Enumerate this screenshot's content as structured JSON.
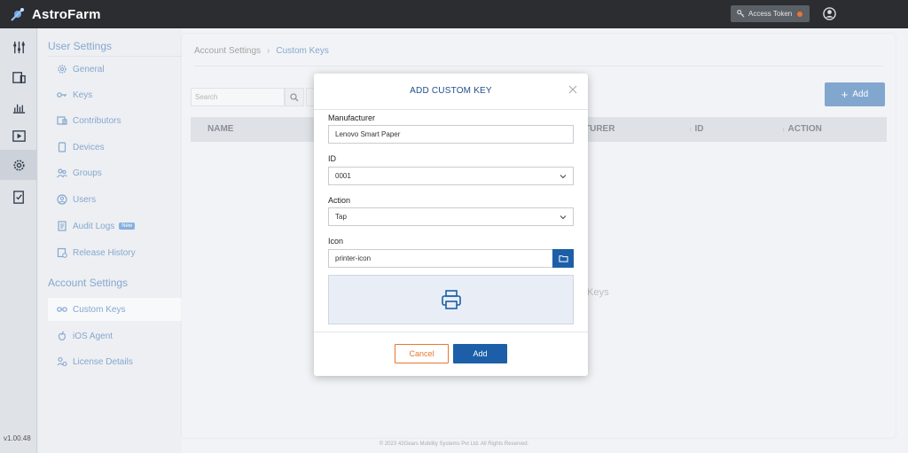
{
  "app": {
    "name": "AstroFarm",
    "version": "v1.00.48"
  },
  "topbar": {
    "access_token_label": "Access Token"
  },
  "sidebar": {
    "user_settings_heading": "User Settings",
    "user_items": [
      {
        "label": "General",
        "icon": "gear-icon"
      },
      {
        "label": "Keys",
        "icon": "key-icon"
      },
      {
        "label": "Contributors",
        "icon": "contributors-icon"
      },
      {
        "label": "Devices",
        "icon": "device-icon"
      },
      {
        "label": "Groups",
        "icon": "groups-icon"
      },
      {
        "label": "Users",
        "icon": "user-icon"
      },
      {
        "label": "Audit Logs",
        "icon": "audit-log-icon",
        "badge": "New"
      },
      {
        "label": "Release History",
        "icon": "release-history-icon"
      }
    ],
    "account_settings_heading": "Account Settings",
    "account_items": [
      {
        "label": "Custom Keys",
        "icon": "custom-keys-icon",
        "active": true
      },
      {
        "label": "iOS Agent",
        "icon": "apple-icon"
      },
      {
        "label": "License Details",
        "icon": "license-icon"
      }
    ]
  },
  "main": {
    "breadcrumb": {
      "parent": "Account Settings",
      "current": "Custom Keys"
    },
    "search_placeholder": "Search",
    "add_label": "Add",
    "columns": [
      "NAME",
      "TURER",
      "ID",
      "ACTION"
    ],
    "empty_text": "n Keys"
  },
  "modal": {
    "title": "ADD CUSTOM KEY",
    "manufacturer": {
      "label": "Manufacturer",
      "value": "Lenovo Smart Paper"
    },
    "id": {
      "label": "ID",
      "value": "0001"
    },
    "action": {
      "label": "Action",
      "value": "Tap"
    },
    "icon": {
      "label": "Icon",
      "value": "printer-icon"
    },
    "cancel_label": "Cancel",
    "add_label": "Add"
  },
  "footer": {
    "text": "© 2023 42Gears Mobility Systems Pvt Ltd. All Rights Reserved."
  },
  "colors": {
    "primary": "#1c5fa8",
    "accent": "#e8772e",
    "topbar": "#2b2d31"
  }
}
